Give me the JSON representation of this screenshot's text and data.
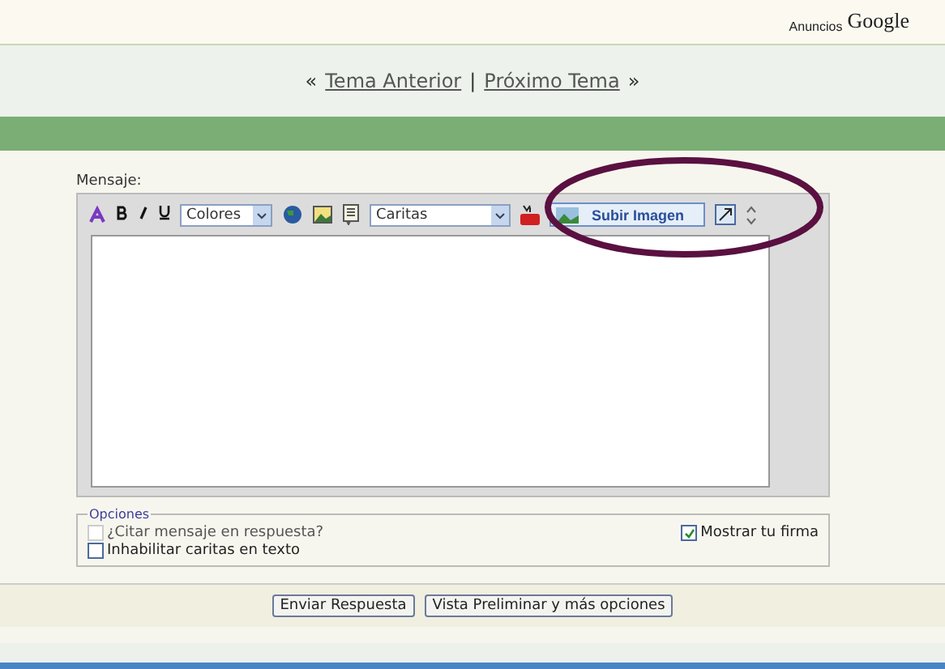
{
  "ads": {
    "label": "Anuncios",
    "brand": "Google"
  },
  "topic_nav": {
    "open": "«",
    "previous": "Tema Anterior",
    "separator": "|",
    "next": "Próximo Tema",
    "close": "»"
  },
  "message": {
    "label": "Mensaje:",
    "colors_select": "Colores",
    "smileys_select": "Caritas",
    "upload_button": "Subir Imagen"
  },
  "options": {
    "legend": "Opciones",
    "left_column": [
      {
        "label": "¿Citar mensaje en respuesta?",
        "checked": false,
        "disabled": true
      },
      {
        "label": "Inhabilitar caritas en texto",
        "checked": false,
        "disabled": false
      }
    ],
    "right_column": [
      {
        "label": "Mostrar tu firma",
        "checked": true,
        "disabled": false
      }
    ]
  },
  "buttons": [
    "Enviar Respuesta",
    "Vista Preliminar y más opciones"
  ]
}
